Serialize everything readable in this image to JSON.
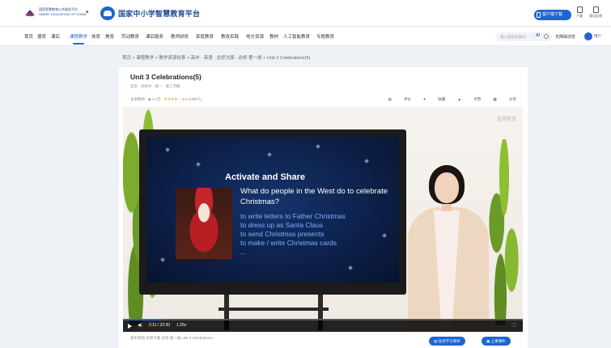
{
  "header": {
    "ministry_logo_text": "国家智慧教育公共服务平台 SMART EDUCATION OF CHINA",
    "site_title": "国家中小学智慧教育平台",
    "app_download_label": "客户端下载",
    "download_label": "下载",
    "feedback_label": "意见反馈",
    "icons": {
      "dropdown": "chevron-down-icon",
      "logo": "platform-logo-icon"
    }
  },
  "nav": {
    "items": [
      "首页",
      "德育",
      "课后",
      "课程教学",
      "体育",
      "美育",
      "劳动教育",
      "课后服务",
      "教师研修",
      "家庭教育",
      "教改实践",
      "地方资源",
      "教材",
      "人工智能教育",
      "专题教育"
    ],
    "active_index": 3,
    "search_placeholder": "输入搜索关键词",
    "ai_label": "AI",
    "login_label": "无障碍浏览",
    "user_label": "用户"
  },
  "breadcrumb": "首页 > 课程教学 > 教学资源检索 > 高中 · 英语 · 北师大版 · 必修 第一册 > Unit 3 Celebrations(5)",
  "course": {
    "title": "Unit 3 Celebrations(5)",
    "subtitle": "北京 · 北师大 · 高一 · 第二学期",
    "meta_prefix": "主讲教师",
    "views": "4.1万",
    "stars": "★★★★☆",
    "rating": "4.9",
    "rating_count": "(1380人)",
    "actions": [
      "评价",
      "收藏",
      "点赞",
      "分享"
    ]
  },
  "slide": {
    "heading": "Activate and Share",
    "question": "What do people in the West do to celebrate Christmas?",
    "list": [
      "to write letters to Father Christmas",
      "to dress up as Santa Claus",
      "to send Christmas presents",
      "to make / write Christmas cards",
      "..."
    ]
  },
  "player": {
    "time": "2:11 / 22:30",
    "speed": "1.25x",
    "progress": 0.1,
    "watermark": "智慧教育"
  },
  "footer": {
    "note": "高中英语 北师大版 必修 第一册 Unit 3 Celebrations",
    "buttons": [
      "任务学习清单",
      "上课课件"
    ]
  },
  "colors": {
    "accent": "#1f66d1",
    "slide_list": "#7fb0ff",
    "star": "#f2a93b"
  }
}
